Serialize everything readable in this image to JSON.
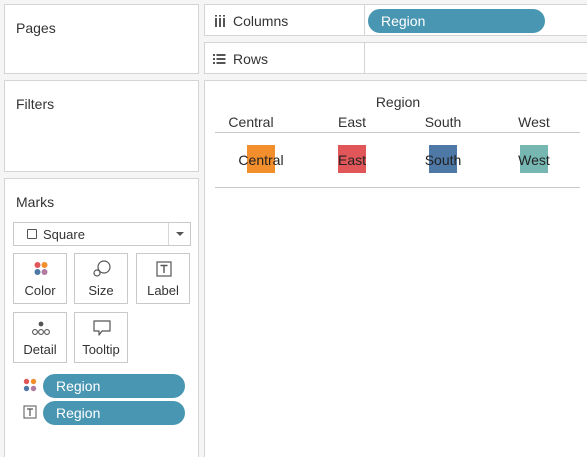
{
  "pages": {
    "title": "Pages"
  },
  "filters": {
    "title": "Filters"
  },
  "marks": {
    "title": "Marks",
    "mark_type": "Square",
    "buttons": {
      "color": "Color",
      "size": "Size",
      "label": "Label",
      "detail": "Detail",
      "tooltip": "Tooltip"
    },
    "pills": [
      {
        "field": "Region",
        "encoding": "color"
      },
      {
        "field": "Region",
        "encoding": "label"
      }
    ]
  },
  "shelves": {
    "columns": {
      "label": "Columns",
      "pill": "Region"
    },
    "rows": {
      "label": "Rows"
    }
  },
  "viz": {
    "field_header": "Region",
    "columns": [
      {
        "header": "Central",
        "label": "Central",
        "color": "#f28e2b"
      },
      {
        "header": "East",
        "label": "East",
        "color": "#e15759"
      },
      {
        "header": "South",
        "label": "South",
        "color": "#4e79a7"
      },
      {
        "header": "West",
        "label": "West",
        "color": "#76b7b2"
      }
    ]
  },
  "colors": {
    "pill": "#4996b2",
    "panel_border": "#d4d4d4",
    "background": "#f5f5f5"
  }
}
